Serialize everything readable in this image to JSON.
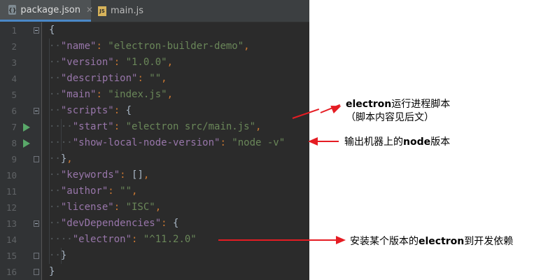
{
  "tabs": [
    {
      "label": "package.json",
      "icon": "json-file-icon",
      "active": true
    },
    {
      "label": "main.js",
      "icon": "js-file-icon",
      "active": false
    }
  ],
  "line_numbers": [
    "1",
    "2",
    "3",
    "4",
    "5",
    "6",
    "7",
    "8",
    "9",
    "10",
    "11",
    "12",
    "13",
    "14",
    "15",
    "16"
  ],
  "code": {
    "name_key": "\"name\"",
    "name_val": "\"electron-builder-demo\"",
    "version_key": "\"version\"",
    "version_val": "\"1.0.0\"",
    "description_key": "\"description\"",
    "description_val": "\"\"",
    "main_key": "\"main\"",
    "main_val": "\"index.js\"",
    "scripts_key": "\"scripts\"",
    "start_key": "\"start\"",
    "start_val": "\"electron src/main.js\"",
    "show_key": "\"show-local-node-version\"",
    "show_val": "\"node -v\"",
    "keywords_key": "\"keywords\"",
    "author_key": "\"author\"",
    "author_val": "\"\"",
    "license_key": "\"license\"",
    "license_val": "\"ISC\"",
    "devdeps_key": "\"devDependencies\"",
    "electron_key": "\"electron\"",
    "electron_val": "\"^11.2.0\"",
    "open_brace": "{",
    "close_brace": "}",
    "brackets": "[]"
  },
  "annotations": {
    "a1_line1_bold": "electron",
    "a1_line1_rest": "运行进程脚本",
    "a1_line2": "（脚本内容见后文）",
    "a2_pre": "输出机器上的",
    "a2_bold": "node",
    "a2_post": "版本",
    "a3_pre": "安装某个版本的",
    "a3_bold": "electron",
    "a3_post": "到开发依赖"
  },
  "colors": {
    "editor_bg": "#2b2b2b",
    "key": "#9876aa",
    "string": "#6a8759",
    "punctuation": "#cc7832",
    "run_icon": "#59a869",
    "annotation_arrow": "#e51c23"
  }
}
